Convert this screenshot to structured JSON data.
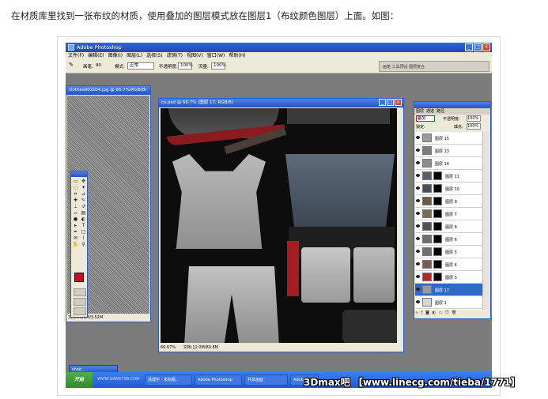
{
  "caption": "在材质库里找到一张布纹的材质，使用叠加的图层模式放在图层1（布纹颜色图层）上面。如图：",
  "app": {
    "title": "Adobe Photoshop",
    "menu": [
      "文件(F)",
      "编辑(E)",
      "图像(I)",
      "图层(L)",
      "选择(S)",
      "滤镜(T)",
      "视图(V)",
      "窗口(W)",
      "帮助(H)"
    ],
    "options": {
      "mode_label": "模式:",
      "mode_value": "正常",
      "opacity_label": "不透明度:",
      "opacity_value": "100%",
      "flow_label": "流量:",
      "flow_value": "100%",
      "brush_label": "画笔:",
      "brush_size": "90"
    },
    "panel_tabs": "画笔  工具预设  图层复合"
  },
  "doc_left": {
    "title": "clothes002s04.jpg @ 66.7%(RGB/8)",
    "status": "文档:3.52M/3.52M"
  },
  "doc_main": {
    "title": "co.psd @ 66.7% (图层 17, RGB/8)",
    "zoom": "66.67%",
    "status": "文档:12.0M/89.8M"
  },
  "layers_panel": {
    "tabs": [
      "图层",
      "通道",
      "路径"
    ],
    "blend_mode": "叠加",
    "opacity_label": "不透明度:",
    "opacity_value": "100%",
    "lock_label": "锁定:",
    "fill_label": "填充:",
    "fill_value": "100%",
    "layers": [
      {
        "name": "图层 15",
        "thumb": "#9c9c9c",
        "mask": false,
        "active": false
      },
      {
        "name": "图层 13",
        "thumb": "#7c7c7c",
        "mask": false,
        "active": false
      },
      {
        "name": "图层 14",
        "thumb": "#8d8d8d",
        "mask": false,
        "active": false
      },
      {
        "name": "图层 11",
        "thumb": "#5a5f66",
        "mask": true,
        "active": false
      },
      {
        "name": "图层 10",
        "thumb": "#484d55",
        "mask": true,
        "active": false
      },
      {
        "name": "图层 9",
        "thumb": "#6a5a48",
        "mask": true,
        "active": false
      },
      {
        "name": "图层 7",
        "thumb": "#7a6a50",
        "mask": true,
        "active": false
      },
      {
        "name": "图层 8",
        "thumb": "#505050",
        "mask": true,
        "active": false
      },
      {
        "name": "图层 6",
        "thumb": "#6d6d6d",
        "mask": true,
        "active": false
      },
      {
        "name": "图层 5",
        "thumb": "#6f6f73",
        "mask": true,
        "active": false
      },
      {
        "name": "图层 4",
        "thumb": "#7b5a52",
        "mask": true,
        "active": false
      },
      {
        "name": "图层 3",
        "thumb": "#b6262c",
        "mask": true,
        "active": false
      },
      {
        "name": "图层 17",
        "thumb": "#9a9a9a",
        "mask": false,
        "active": true
      },
      {
        "name": "图层 1",
        "thumb": "#d7d7d7",
        "mask": false,
        "active": false
      }
    ]
  },
  "taskbar": {
    "start": "开始",
    "site": "WWW.GAME798.COM",
    "items": [
      "清理字 · 未标题..",
      "Adobe Photoshop",
      "共享画面",
      "Adobe..."
    ],
    "mini_doc": "shoe..."
  },
  "watermark": "3Dmax吧 【www.linecg.com/tieba/1771】"
}
